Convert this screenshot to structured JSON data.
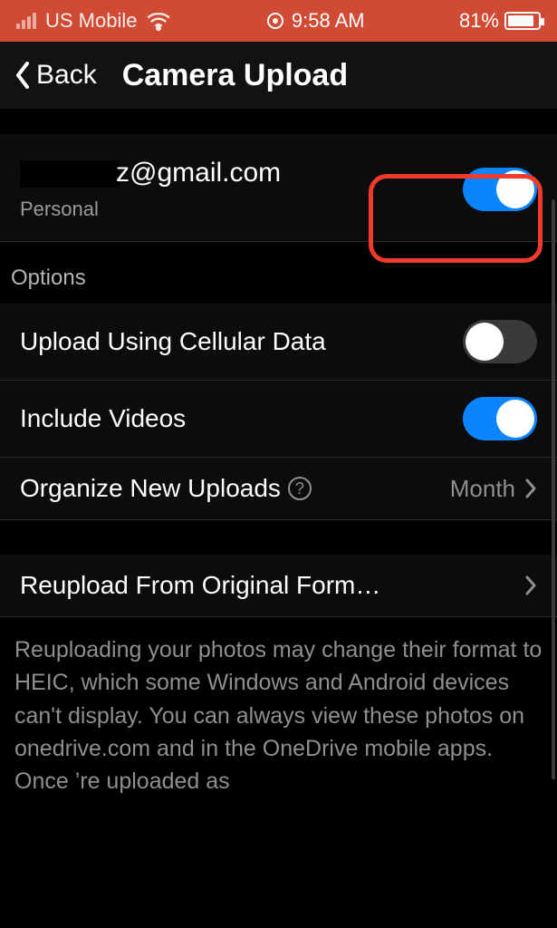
{
  "status_bar": {
    "carrier": "US Mobile",
    "time": "9:58 AM",
    "battery_pct": "81%"
  },
  "nav": {
    "back_label": "Back",
    "title": "Camera Upload"
  },
  "account": {
    "email_suffix": "z@gmail.com",
    "type": "Personal",
    "toggle_on": true
  },
  "options_header": "Options",
  "rows": {
    "cellular": {
      "label": "Upload Using Cellular Data",
      "on": false
    },
    "videos": {
      "label": "Include Videos",
      "on": true
    },
    "organize": {
      "label": "Organize New Uploads",
      "value": "Month"
    },
    "reupload": {
      "label": "Reupload From Original Form…"
    }
  },
  "footer": "Reuploading your photos may change their format to HEIC, which some Windows and Android devices can't display. You can always view these photos on onedrive.com and in the OneDrive mobile apps. Once ’re uploaded as"
}
